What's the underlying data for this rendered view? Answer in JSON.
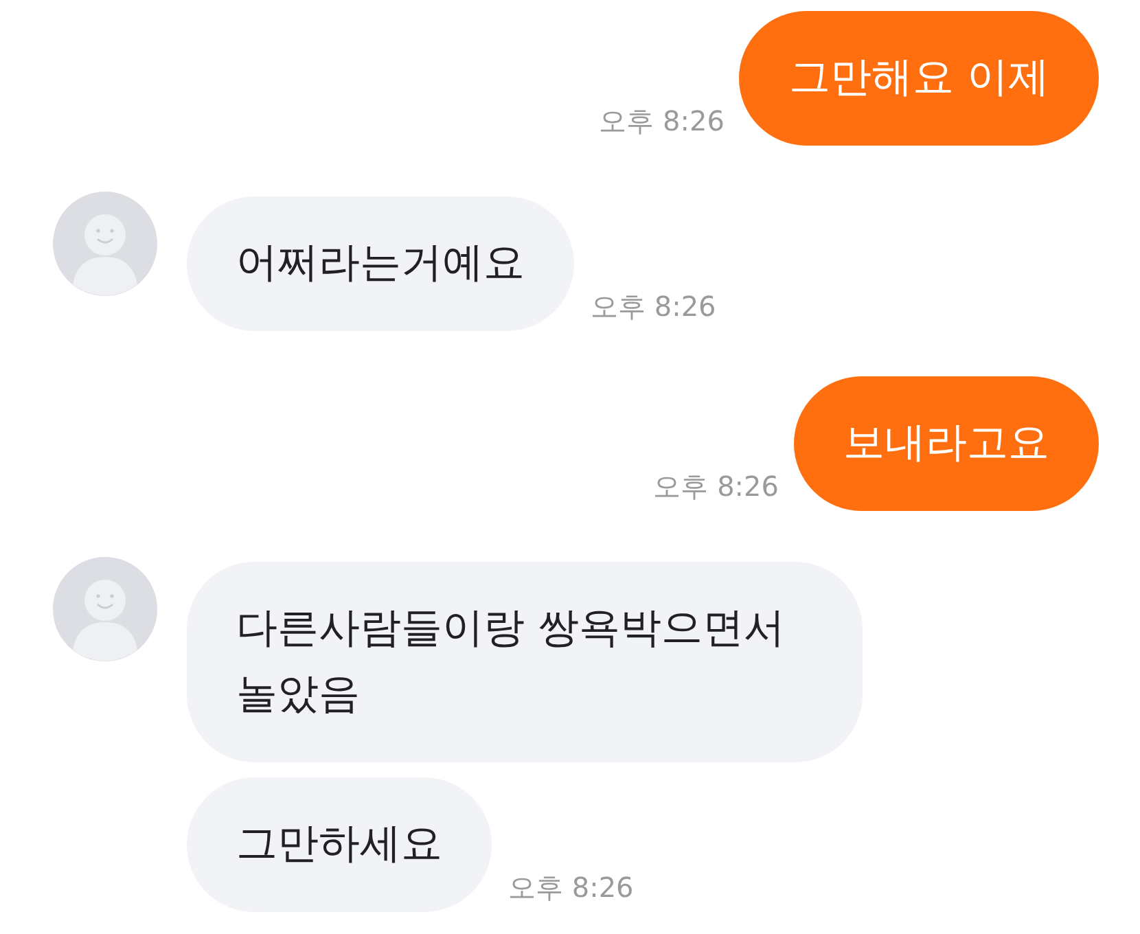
{
  "messages": [
    {
      "kind": "outgoing",
      "bubbles": [
        "그만해요 이제"
      ],
      "time": "오후 8:26"
    },
    {
      "kind": "incoming",
      "bubbles": [
        "어쩌라는거예요"
      ],
      "time": "오후 8:26"
    },
    {
      "kind": "outgoing",
      "bubbles": [
        "보내라고요"
      ],
      "time": "오후 8:26"
    },
    {
      "kind": "incoming",
      "bubbles": [
        "다른사람들이랑 쌍욕박으면서 놀았음",
        "그만하세요"
      ],
      "time": "오후 8:26"
    }
  ]
}
